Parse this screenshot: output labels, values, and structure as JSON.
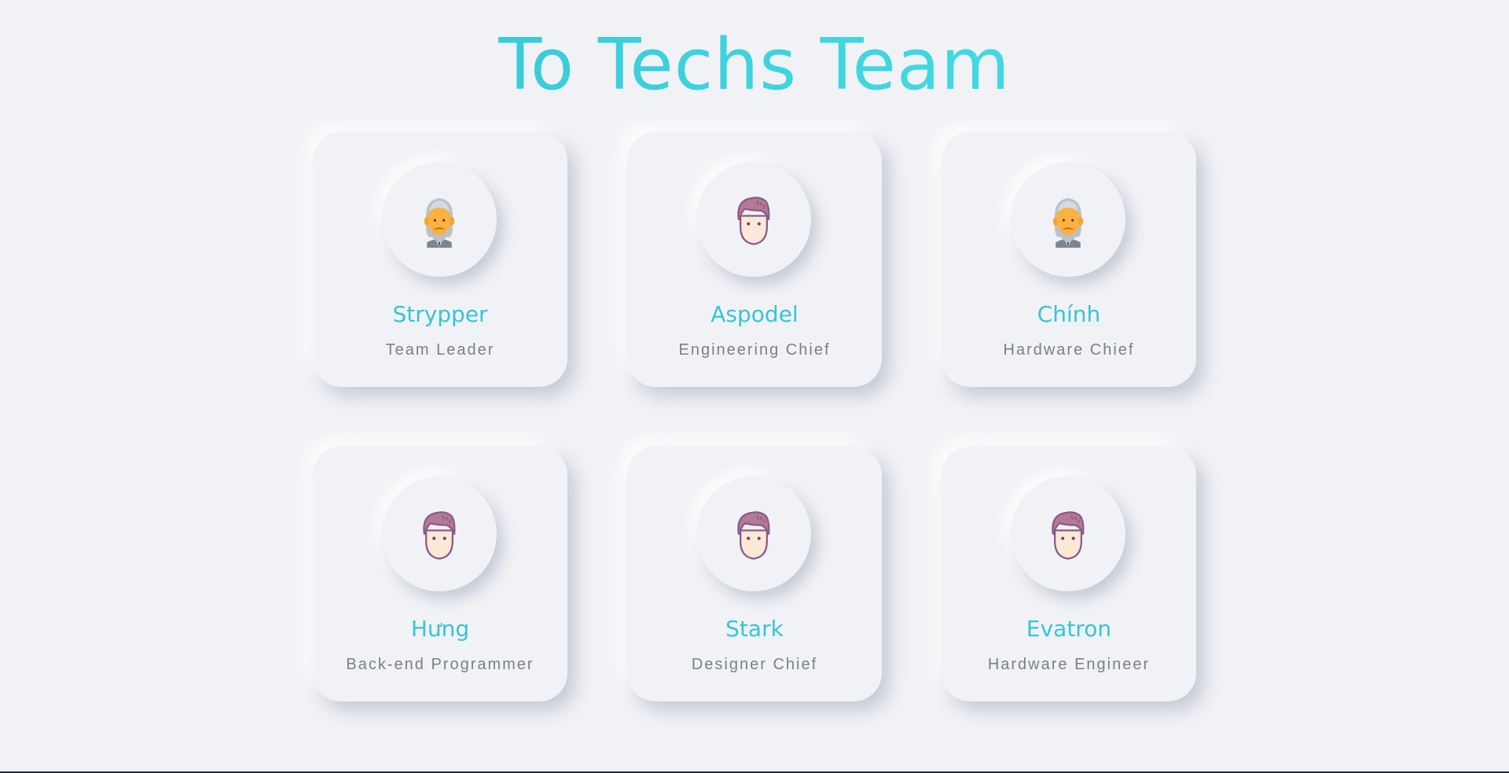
{
  "page": {
    "title": "To Techs Team"
  },
  "colors": {
    "background": "#f1f2f6",
    "accent": "#35c5d6",
    "role_text": "#7a7f89"
  },
  "members": [
    {
      "name": "Strypper",
      "role": "Team Leader",
      "avatar": "old-man-icon"
    },
    {
      "name": "Aspodel",
      "role": "Engineering Chief",
      "avatar": "young-man-icon"
    },
    {
      "name": "Chính",
      "role": "Hardware Chief",
      "avatar": "old-man-icon"
    },
    {
      "name": "Hưng",
      "role": "Back-end Programmer",
      "avatar": "young-man-icon"
    },
    {
      "name": "Stark",
      "role": "Designer Chief",
      "avatar": "young-man-icon"
    },
    {
      "name": "Evatron",
      "role": "Hardware Engineer",
      "avatar": "young-man-icon"
    }
  ]
}
